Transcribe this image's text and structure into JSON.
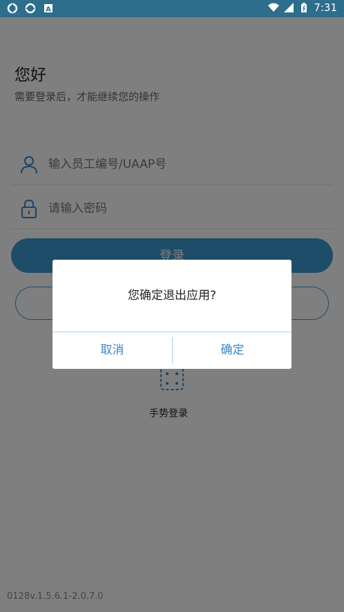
{
  "status_bar": {
    "time": "7:31",
    "left_icons": [
      "sync-icon",
      "sync-icon",
      "a-icon"
    ],
    "right_icons": [
      "wifi-icon",
      "signal-icon",
      "battery-icon"
    ]
  },
  "login": {
    "greeting": "您好",
    "subtitle": "需要登录后，才能继续您的操作",
    "username_placeholder": "输入员工编号/UAAP号",
    "password_placeholder": "请输入密码",
    "login_button": "登录",
    "gesture_label": "手势登录",
    "version": "0128v.1.5.6.1-2.0.7.0"
  },
  "dialog": {
    "message": "您确定退出应用?",
    "cancel": "取消",
    "confirm": "确定"
  },
  "colors": {
    "accent": "#3a9ad0",
    "status_bar": "#2c6e8c"
  }
}
